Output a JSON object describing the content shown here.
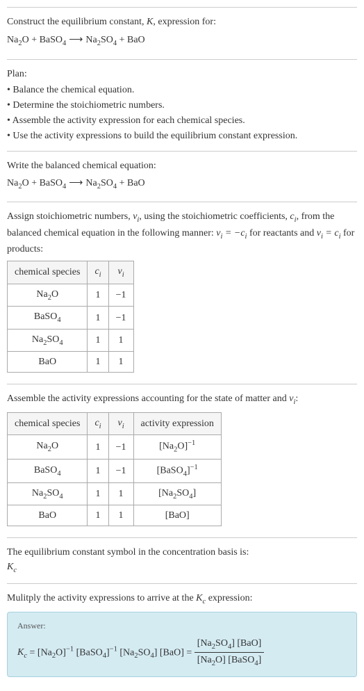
{
  "intro": {
    "line1_a": "Construct the equilibrium constant, ",
    "line1_k": "K",
    "line1_b": ", expression for:",
    "eq": "Na₂O + BaSO₄ ⟶ Na₂SO₄ + BaO"
  },
  "plan": {
    "title": "Plan:",
    "items": [
      "• Balance the chemical equation.",
      "• Determine the stoichiometric numbers.",
      "• Assemble the activity expression for each chemical species.",
      "• Use the activity expressions to build the equilibrium constant expression."
    ]
  },
  "balanced": {
    "label": "Write the balanced chemical equation:",
    "eq": "Na₂O + BaSO₄ ⟶ Na₂SO₄ + BaO"
  },
  "stoich": {
    "text_a": "Assign stoichiometric numbers, ",
    "text_b": ", using the stoichiometric coefficients, ",
    "text_c": ", from the balanced chemical equation in the following manner: ",
    "text_d": " for reactants and ",
    "text_e": " for products:",
    "nu": "νᵢ",
    "ci": "cᵢ",
    "rel1": "νᵢ = −cᵢ",
    "rel2": "νᵢ = cᵢ",
    "headers": [
      "chemical species",
      "cᵢ",
      "νᵢ"
    ],
    "rows": [
      [
        "Na₂O",
        "1",
        "−1"
      ],
      [
        "BaSO₄",
        "1",
        "−1"
      ],
      [
        "Na₂SO₄",
        "1",
        "1"
      ],
      [
        "BaO",
        "1",
        "1"
      ]
    ]
  },
  "activity": {
    "label_a": "Assemble the activity expressions accounting for the state of matter and ",
    "label_b": ":",
    "nu": "νᵢ",
    "headers": [
      "chemical species",
      "cᵢ",
      "νᵢ",
      "activity expression"
    ],
    "rows": [
      [
        "Na₂O",
        "1",
        "−1",
        "[Na₂O]⁻¹"
      ],
      [
        "BaSO₄",
        "1",
        "−1",
        "[BaSO₄]⁻¹"
      ],
      [
        "Na₂SO₄",
        "1",
        "1",
        "[Na₂SO₄]"
      ],
      [
        "BaO",
        "1",
        "1",
        "[BaO]"
      ]
    ]
  },
  "symbol": {
    "label": "The equilibrium constant symbol in the concentration basis is:",
    "kc": "K_c"
  },
  "multiply": {
    "label_a": "Mulitply the activity expressions to arrive at the ",
    "label_b": " expression:",
    "kc": "K_c"
  },
  "answer": {
    "label": "Answer:",
    "lhs": "K_c = [Na₂O]⁻¹ [BaSO₄]⁻¹ [Na₂SO₄] [BaO] = ",
    "num": "[Na₂SO₄] [BaO]",
    "den": "[Na₂O] [BaSO₄]"
  }
}
